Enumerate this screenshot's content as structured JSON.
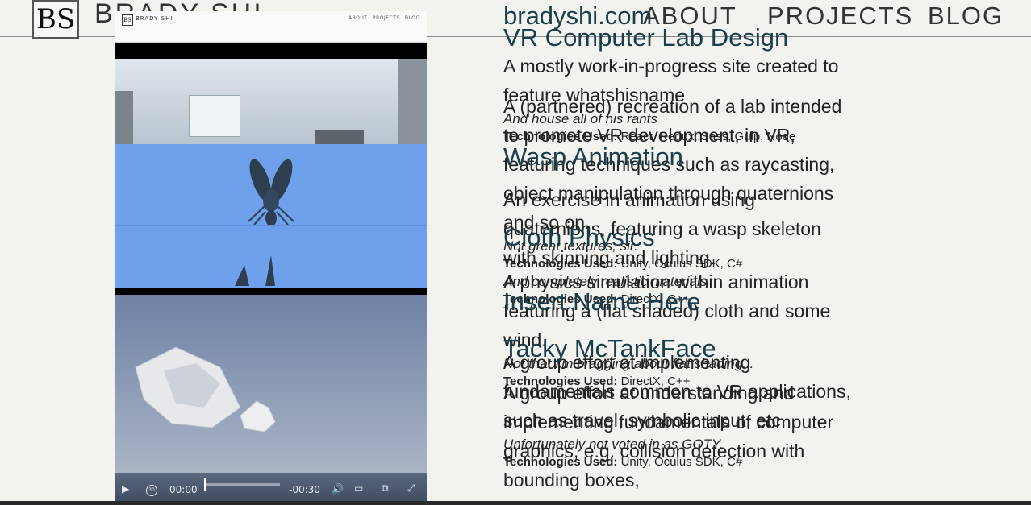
{
  "header": {
    "logo_text": "BS",
    "brand_name": "BRADY SHI",
    "site_link": "bradyshi.com",
    "nav": {
      "about": "ABOUT",
      "projects": "PROJECTS",
      "blog": "BLOG"
    }
  },
  "video": {
    "mini_header": {
      "logo_text": "BS",
      "brand_name": "BRADY SHI",
      "about": "ABOUT",
      "projects": "PROJECTS",
      "blog": "BLOG"
    },
    "controls": {
      "play_icon": "▶",
      "skip_icon": "30",
      "current_time": "00:00",
      "remaining_time": "-00:30",
      "volume_icon": "🔊",
      "airplay_icon": "▭",
      "pip_icon": "⧉",
      "fullscreen_icon": "⤢"
    },
    "progress_fraction": 0.0
  },
  "projects": [
    {
      "title": "VR Computer Lab Design",
      "description": "A (partnered) recreation of a lab intended to promote VR development, in VR, featuring techniques such as raycasting, object manipulation through quaternions and so on.",
      "note": "Not great textures, sir.",
      "tech_label": "Technologies Used:",
      "tech": "Unity, Oculus SDK, C#"
    },
    {
      "title": "bradyshi.com",
      "description": "A mostly work-in-progress site created to feature whatshisname",
      "note": "And house all of his rants",
      "tech_label": "Technologies Used:",
      "tech": "React, Redux, Sass, Gulp, Node"
    },
    {
      "title": "Wasp Animation",
      "description": "An exercise in animation using quaternions, featuring a wasp skeleton with skinning and lighting.",
      "note": "And completely realistic materials",
      "tech_label": "Technologies Used:",
      "tech": "DirectX, C++"
    },
    {
      "title": "Cloth Physics",
      "description": "A physics simulation within animation featuring a (flat shaded) cloth and some wind.",
      "note": "Not that I'm bragging about flat shading...",
      "tech_label": "Technologies Used:",
      "tech": "DirectX, C++"
    },
    {
      "title": "Insert Name Here",
      "description": "A group effort at implementing fundamentals common to VR applications, such as travel, symbolic input, etc.",
      "note": "Unfortunately not voted in as GOTY.",
      "tech_label": "Technologies Used:",
      "tech": "Unity, Oculus SDK, C#"
    },
    {
      "title": "Tacky McTankFace",
      "description": "A group effort at understanding and implementing fundamentals of computer graphics, e.g. collision detection with bounding boxes,"
    }
  ]
}
